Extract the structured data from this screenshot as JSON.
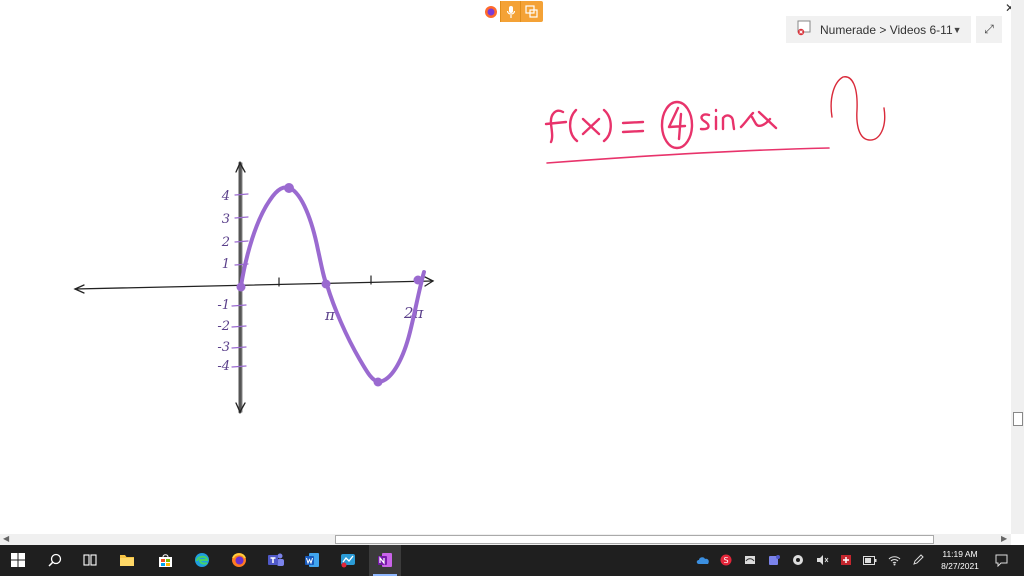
{
  "notebook": {
    "breadcrumb": "Numerade > Videos 6-11"
  },
  "ink": {
    "equation": "f(x) = 4 sin x",
    "y_ticks": [
      "4",
      "3",
      "2",
      "1",
      "-1",
      "-2",
      "-3",
      "-4"
    ],
    "x_ticks": [
      "π",
      "2π"
    ]
  },
  "taskbar": {
    "time": "11:19 AM",
    "date": "8/27/2021"
  },
  "colors": {
    "ink_pink": "#e8336b",
    "ink_red": "#d92a3a",
    "ink_purple": "#9a6ad0",
    "axis": "#222222",
    "taskbar": "#1f1f1f",
    "toolbar": "#f4a236"
  },
  "icons": [
    "firefox-icon",
    "microphone-icon",
    "window-icon",
    "notebook-icon",
    "expand-icon",
    "close-icon",
    "windows-start-icon",
    "search-icon",
    "task-view-icon",
    "file-explorer-icon",
    "store-icon",
    "edge-icon",
    "teams-icon",
    "word-icon",
    "onenote-icon"
  ]
}
